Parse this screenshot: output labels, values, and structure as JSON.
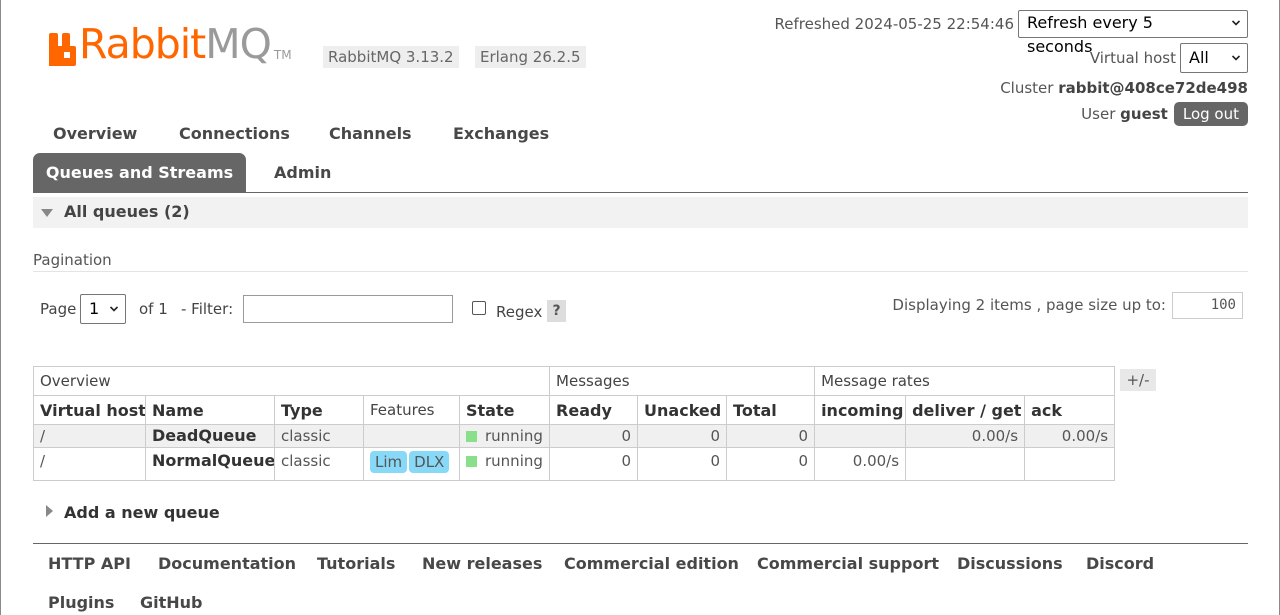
{
  "header": {
    "logo_text_primary": "Rabbit",
    "logo_text_secondary": "MQ",
    "logo_tm": "TM",
    "rabbitmq_version": "RabbitMQ 3.13.2",
    "erlang_version": "Erlang 26.2.5",
    "refreshed": "Refreshed 2024-05-25 22:54:46",
    "refresh_select": "Refresh every 5 seconds",
    "virtual_host_label": "Virtual host",
    "virtual_host_select": "All",
    "cluster_label": "Cluster",
    "cluster_name": "rabbit@408ce72de498",
    "user_label": "User",
    "user_name": "guest",
    "logout_label": "Log out"
  },
  "colors": {
    "brand_orange": "#ff6600",
    "active_tab": "#666666",
    "running": "#8ae08a",
    "feature_badge": "#88d8f7"
  },
  "nav": {
    "overview": "Overview",
    "connections": "Connections",
    "channels": "Channels",
    "exchanges": "Exchanges",
    "queues": "Queues and Streams",
    "admin": "Admin",
    "active": "Queues and Streams"
  },
  "section": {
    "title": "All queues (2)"
  },
  "pagination": {
    "title": "Pagination",
    "page_label": "Page",
    "page_value": "1",
    "of_label": "of 1",
    "filter_label": "- Filter:",
    "filter_value": "",
    "regex_label": "Regex",
    "regex_checked": false,
    "help_label": "?",
    "display_label": "Displaying 2 items , page size up to:",
    "page_size": "100"
  },
  "table": {
    "groups": {
      "overview": "Overview",
      "messages": "Messages",
      "rates": "Message rates"
    },
    "columns": {
      "vhost": "Virtual host",
      "name": "Name",
      "type": "Type",
      "features": "Features",
      "state": "State",
      "ready": "Ready",
      "unacked": "Unacked",
      "total": "Total",
      "incoming": "incoming",
      "deliver_get": "deliver / get",
      "ack": "ack"
    },
    "toggle_columns": "+/-",
    "rows": [
      {
        "vhost": "/",
        "name": "DeadQueue",
        "type": "classic",
        "features": [],
        "state": "running",
        "ready": "0",
        "unacked": "0",
        "total": "0",
        "incoming": "",
        "deliver_get": "0.00/s",
        "ack": "0.00/s"
      },
      {
        "vhost": "/",
        "name": "NormalQueue",
        "type": "classic",
        "features": [
          "Lim",
          "DLX"
        ],
        "state": "running",
        "ready": "0",
        "unacked": "0",
        "total": "0",
        "incoming": "0.00/s",
        "deliver_get": "",
        "ack": ""
      }
    ]
  },
  "add_queue": {
    "label": "Add a new queue"
  },
  "footer": {
    "links": [
      "HTTP API",
      "Documentation",
      "Tutorials",
      "New releases",
      "Commercial edition",
      "Commercial support",
      "Discussions",
      "Discord",
      "Plugins",
      "GitHub"
    ]
  }
}
